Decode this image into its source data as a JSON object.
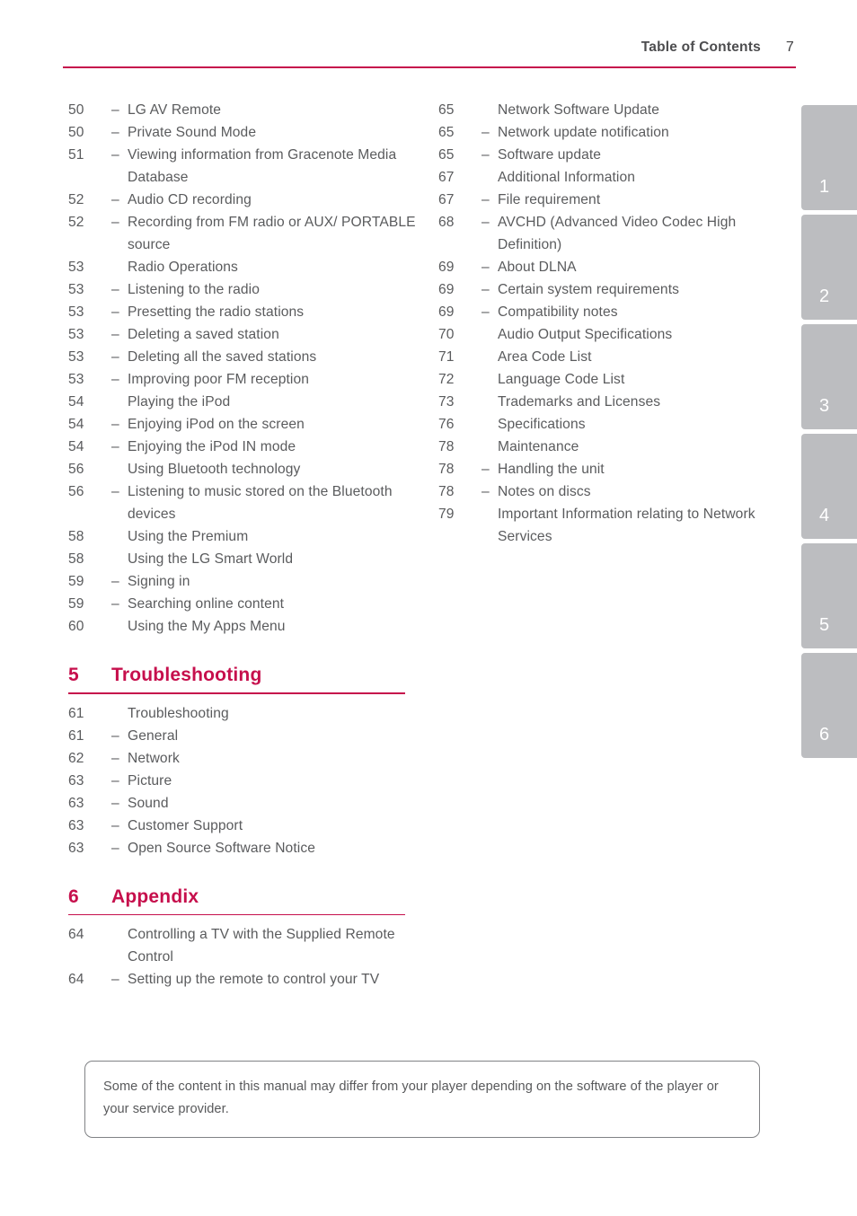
{
  "header": {
    "title": "Table of Contents",
    "page_number": "7",
    "rule_color": "#c60f4c"
  },
  "accent_color": "#c60f4c",
  "text_color": "#58595b",
  "tab_color": "#bcbdc0",
  "left_column": [
    {
      "page": "50",
      "dash": "–",
      "label": "LG AV Remote",
      "level": "sub"
    },
    {
      "page": "50",
      "dash": "–",
      "label": "Private Sound Mode",
      "level": "sub"
    },
    {
      "page": "51",
      "dash": "–",
      "label": "Viewing information from Gracenote Media Database",
      "level": "sub"
    },
    {
      "page": "52",
      "dash": "–",
      "label": "Audio CD recording",
      "level": "sub"
    },
    {
      "page": "52",
      "dash": "–",
      "label": "Recording from FM radio or AUX/ PORTABLE source",
      "level": "sub"
    },
    {
      "page": "53",
      "dash": "",
      "label": "Radio Operations",
      "level": "top"
    },
    {
      "page": "53",
      "dash": "–",
      "label": "Listening to the radio",
      "level": "sub"
    },
    {
      "page": "53",
      "dash": "–",
      "label": "Presetting the radio stations",
      "level": "sub"
    },
    {
      "page": "53",
      "dash": "–",
      "label": "Deleting a saved station",
      "level": "sub"
    },
    {
      "page": "53",
      "dash": "–",
      "label": "Deleting all the saved stations",
      "level": "sub"
    },
    {
      "page": "53",
      "dash": "–",
      "label": "Improving poor FM reception",
      "level": "sub"
    },
    {
      "page": "54",
      "dash": "",
      "label": "Playing the iPod",
      "level": "top"
    },
    {
      "page": "54",
      "dash": "–",
      "label": "Enjoying iPod on the screen",
      "level": "sub"
    },
    {
      "page": "54",
      "dash": "–",
      "label": "Enjoying the iPod IN mode",
      "level": "sub"
    },
    {
      "page": "56",
      "dash": "",
      "label": "Using Bluetooth technology",
      "level": "top"
    },
    {
      "page": "56",
      "dash": "–",
      "label": "Listening to music stored on the Bluetooth devices",
      "level": "sub"
    },
    {
      "page": "58",
      "dash": "",
      "label": "Using the Premium",
      "level": "top"
    },
    {
      "page": "58",
      "dash": "",
      "label": "Using the LG Smart World",
      "level": "top"
    },
    {
      "page": "59",
      "dash": "–",
      "label": "Signing in",
      "level": "sub"
    },
    {
      "page": "59",
      "dash": "–",
      "label": "Searching online content",
      "level": "sub"
    },
    {
      "page": "60",
      "dash": "",
      "label": "Using the My Apps Menu",
      "level": "top"
    }
  ],
  "sections": [
    {
      "number": "5",
      "title": "Troubleshooting",
      "entries": [
        {
          "page": "61",
          "dash": "",
          "label": "Troubleshooting",
          "level": "top"
        },
        {
          "page": "61",
          "dash": "–",
          "label": "General",
          "level": "sub"
        },
        {
          "page": "62",
          "dash": "–",
          "label": "Network",
          "level": "sub"
        },
        {
          "page": "63",
          "dash": "–",
          "label": "Picture",
          "level": "sub"
        },
        {
          "page": "63",
          "dash": "–",
          "label": "Sound",
          "level": "sub"
        },
        {
          "page": "63",
          "dash": "–",
          "label": "Customer Support",
          "level": "sub"
        },
        {
          "page": "63",
          "dash": "–",
          "label": "Open Source Software Notice",
          "level": "sub"
        }
      ]
    },
    {
      "number": "6",
      "title": "Appendix",
      "entries": [
        {
          "page": "64",
          "dash": "",
          "label": "Controlling a TV with the Supplied Remote Control",
          "level": "top"
        },
        {
          "page": "64",
          "dash": "–",
          "label": "Setting up the remote to control your TV",
          "level": "sub"
        }
      ]
    }
  ],
  "right_column": [
    {
      "page": "65",
      "dash": "",
      "label": "Network Software Update",
      "level": "top"
    },
    {
      "page": "65",
      "dash": "–",
      "label": "Network update notification",
      "level": "sub"
    },
    {
      "page": "65",
      "dash": "–",
      "label": "Software update",
      "level": "sub"
    },
    {
      "page": "67",
      "dash": "",
      "label": "Additional Information",
      "level": "top"
    },
    {
      "page": "67",
      "dash": "–",
      "label": "File requirement",
      "level": "sub"
    },
    {
      "page": "68",
      "dash": "–",
      "label": "AVCHD (Advanced Video Codec High Definition)",
      "level": "sub"
    },
    {
      "page": "69",
      "dash": "–",
      "label": "About DLNA",
      "level": "sub"
    },
    {
      "page": "69",
      "dash": "–",
      "label": "Certain system requirements",
      "level": "sub"
    },
    {
      "page": "69",
      "dash": "–",
      "label": "Compatibility notes",
      "level": "sub"
    },
    {
      "page": "70",
      "dash": "",
      "label": "Audio Output Specifications",
      "level": "top"
    },
    {
      "page": "71",
      "dash": "",
      "label": "Area Code List",
      "level": "top"
    },
    {
      "page": "72",
      "dash": "",
      "label": "Language Code List",
      "level": "top"
    },
    {
      "page": "73",
      "dash": "",
      "label": "Trademarks and Licenses",
      "level": "top"
    },
    {
      "page": "76",
      "dash": "",
      "label": "Specifications",
      "level": "top"
    },
    {
      "page": "78",
      "dash": "",
      "label": "Maintenance",
      "level": "top"
    },
    {
      "page": "78",
      "dash": "–",
      "label": "Handling the unit",
      "level": "sub"
    },
    {
      "page": "78",
      "dash": "–",
      "label": "Notes on discs",
      "level": "sub"
    },
    {
      "page": "79",
      "dash": "",
      "label": "Important Information relating to Network Services",
      "level": "top"
    }
  ],
  "chapter_tabs": [
    {
      "label": "1"
    },
    {
      "label": "2"
    },
    {
      "label": "3"
    },
    {
      "label": "4"
    },
    {
      "label": "5"
    },
    {
      "label": "6"
    }
  ],
  "note": {
    "text": "Some of the content in this manual may differ from your player depending on the software of the player or your service provider."
  }
}
